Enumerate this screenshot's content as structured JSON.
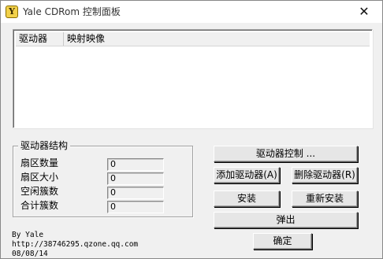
{
  "window": {
    "title": "Yale CDRom 控制面板",
    "icon_letter": "Y",
    "close_glyph": "✕"
  },
  "list": {
    "columns": [
      "驱动器",
      "映射映像"
    ]
  },
  "structure": {
    "title": "驱动器结构",
    "fields": [
      {
        "label": "扇区数量",
        "value": "0"
      },
      {
        "label": "扇区大小",
        "value": "0"
      },
      {
        "label": "空闲簇数",
        "value": "0"
      },
      {
        "label": "合计簇数",
        "value": "0"
      }
    ]
  },
  "buttons": {
    "drive_control": "驱动器控制 ...",
    "add_drive": "添加驱动器(A)",
    "remove_drive": "删除驱动器(R)",
    "install": "安装",
    "reinstall": "重新安装",
    "eject": "弹出",
    "ok": "确定"
  },
  "info": {
    "author": "By Yale",
    "url": "http://38746295.qzone.qq.com",
    "date": "08/08/14"
  }
}
